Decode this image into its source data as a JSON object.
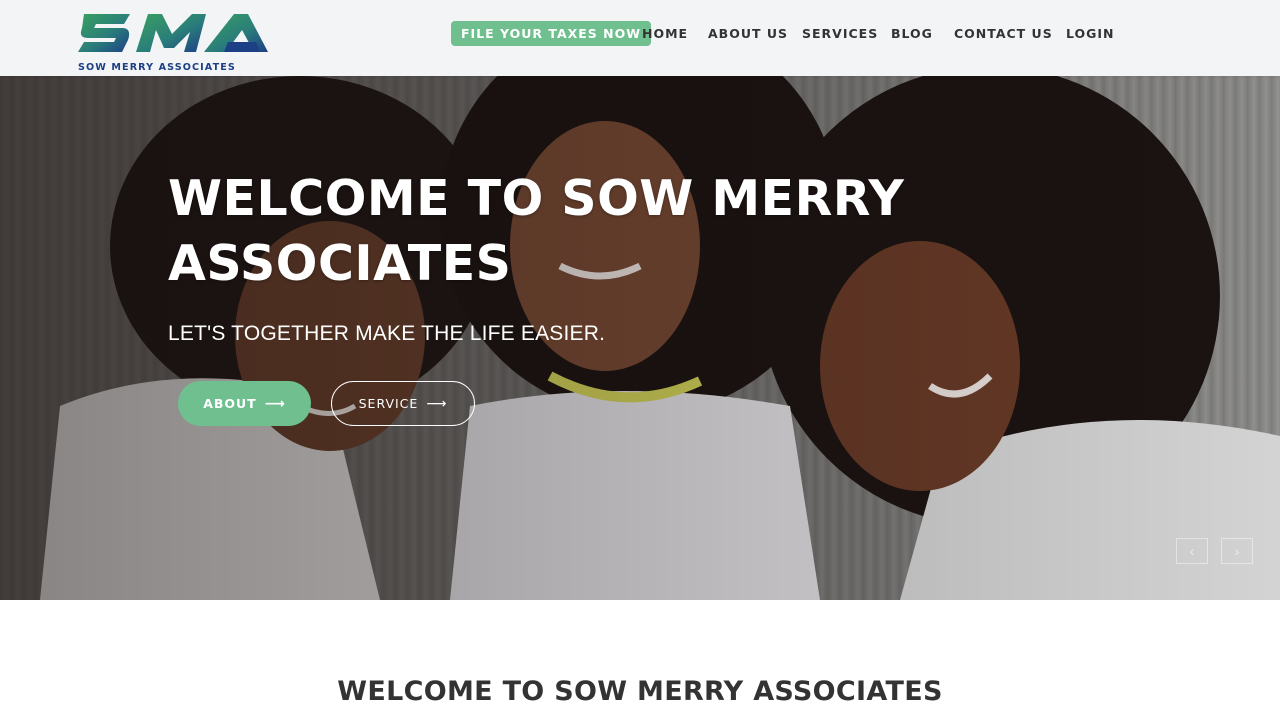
{
  "brand": {
    "logo_text": "SMA",
    "name": "SOW MERRY ASSOCIATES",
    "colors": {
      "green": "#2e8a5f",
      "blue": "#1d3f86"
    }
  },
  "nav": {
    "cta": "FILE YOUR TAXES NOW",
    "items": [
      "HOME",
      "ABOUT US",
      "SERVICES",
      "BLOG",
      "CONTACT US",
      "LOGIN"
    ]
  },
  "hero": {
    "title": "WELCOME TO SOW MERRY ASSOCIATES",
    "subtitle": "LET'S TOGETHER MAKE THE LIFE EASIER.",
    "buttons": {
      "about": "ABOUT",
      "service": "SERVICE"
    },
    "image": "three smiling women photo",
    "slider": {
      "prev_icon": "chevron-left-icon",
      "next_icon": "chevron-right-icon"
    }
  },
  "welcome": {
    "title": "WELCOME TO SOW MERRY ASSOCIATES"
  },
  "theme": {
    "accent": "#6fbf8f",
    "header_bg": "#f2f4f6",
    "text": "#333333"
  }
}
